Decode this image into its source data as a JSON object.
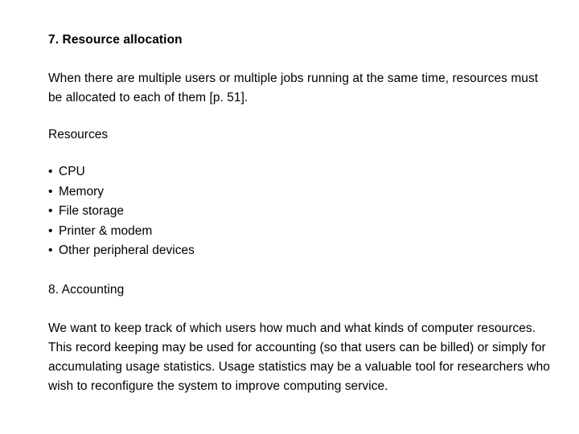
{
  "slide": {
    "background_color": "#ffffff",
    "text_color": "#000000",
    "sections": {
      "section7": {
        "heading": "7. Resource allocation",
        "paragraph": "When there are multiple users or multiple jobs running at the same time, resources must be allocated to each of them [p. 51].",
        "subheading": "Resources",
        "bullet_glyph": "•",
        "bullets": [
          "CPU",
          "Memory",
          "File storage",
          "Printer & modem",
          "Other peripheral devices"
        ]
      },
      "section8": {
        "heading": "8. Accounting",
        "paragraph": "We want to keep track of which users how much and what kinds of computer resources. This record keeping may be used for accounting (so that users can be billed) or simply for accumulating usage statistics. Usage statistics may be a valuable tool for researchers who wish to reconfigure the system to improve computing service."
      }
    }
  }
}
